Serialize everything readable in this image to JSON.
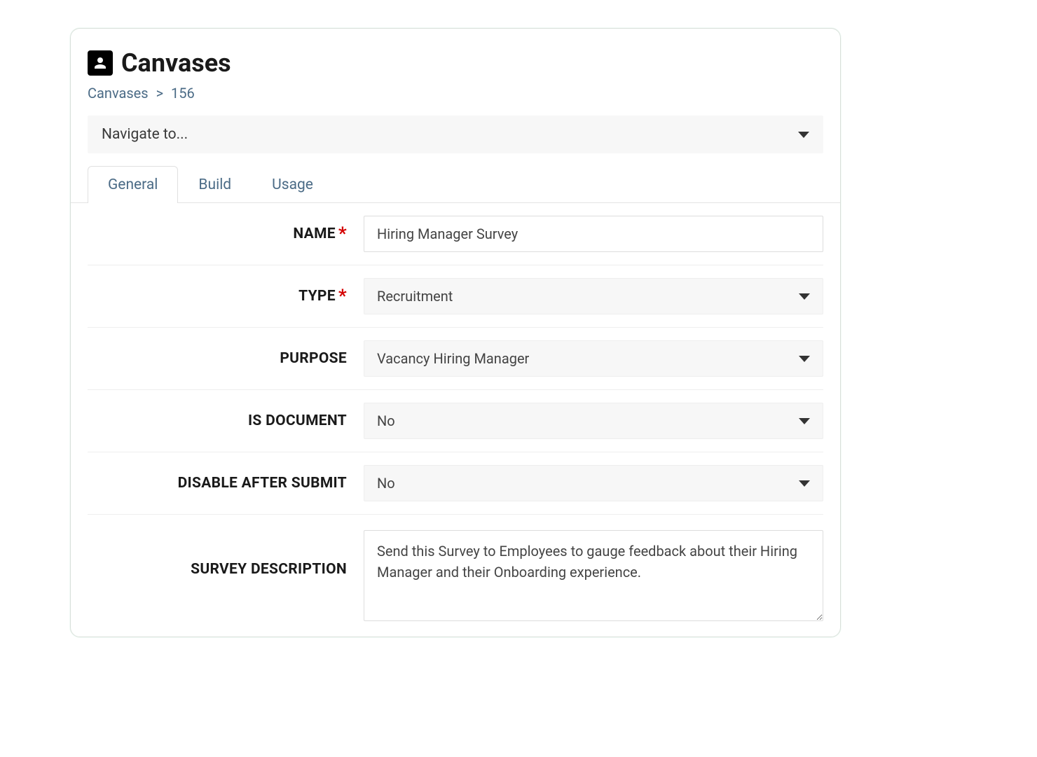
{
  "header": {
    "title": "Canvases"
  },
  "breadcrumb": {
    "root": "Canvases",
    "id": "156"
  },
  "navSelect": {
    "label": "Navigate to..."
  },
  "tabs": [
    {
      "label": "General",
      "active": true
    },
    {
      "label": "Build",
      "active": false
    },
    {
      "label": "Usage",
      "active": false
    }
  ],
  "form": {
    "name": {
      "label": "NAME",
      "required": true,
      "value": "Hiring Manager Survey"
    },
    "type": {
      "label": "TYPE",
      "required": true,
      "value": "Recruitment"
    },
    "purpose": {
      "label": "PURPOSE",
      "required": false,
      "value": "Vacancy Hiring Manager"
    },
    "isDocument": {
      "label": "IS DOCUMENT",
      "required": false,
      "value": "No"
    },
    "disableAfterSubmit": {
      "label": "DISABLE AFTER SUBMIT",
      "required": false,
      "value": "No"
    },
    "surveyDescription": {
      "label": "SURVEY DESCRIPTION",
      "required": false,
      "value": "Send this Survey to Employees to gauge feedback about their Hiring Manager and their Onboarding experience."
    }
  },
  "requiredMark": "*"
}
